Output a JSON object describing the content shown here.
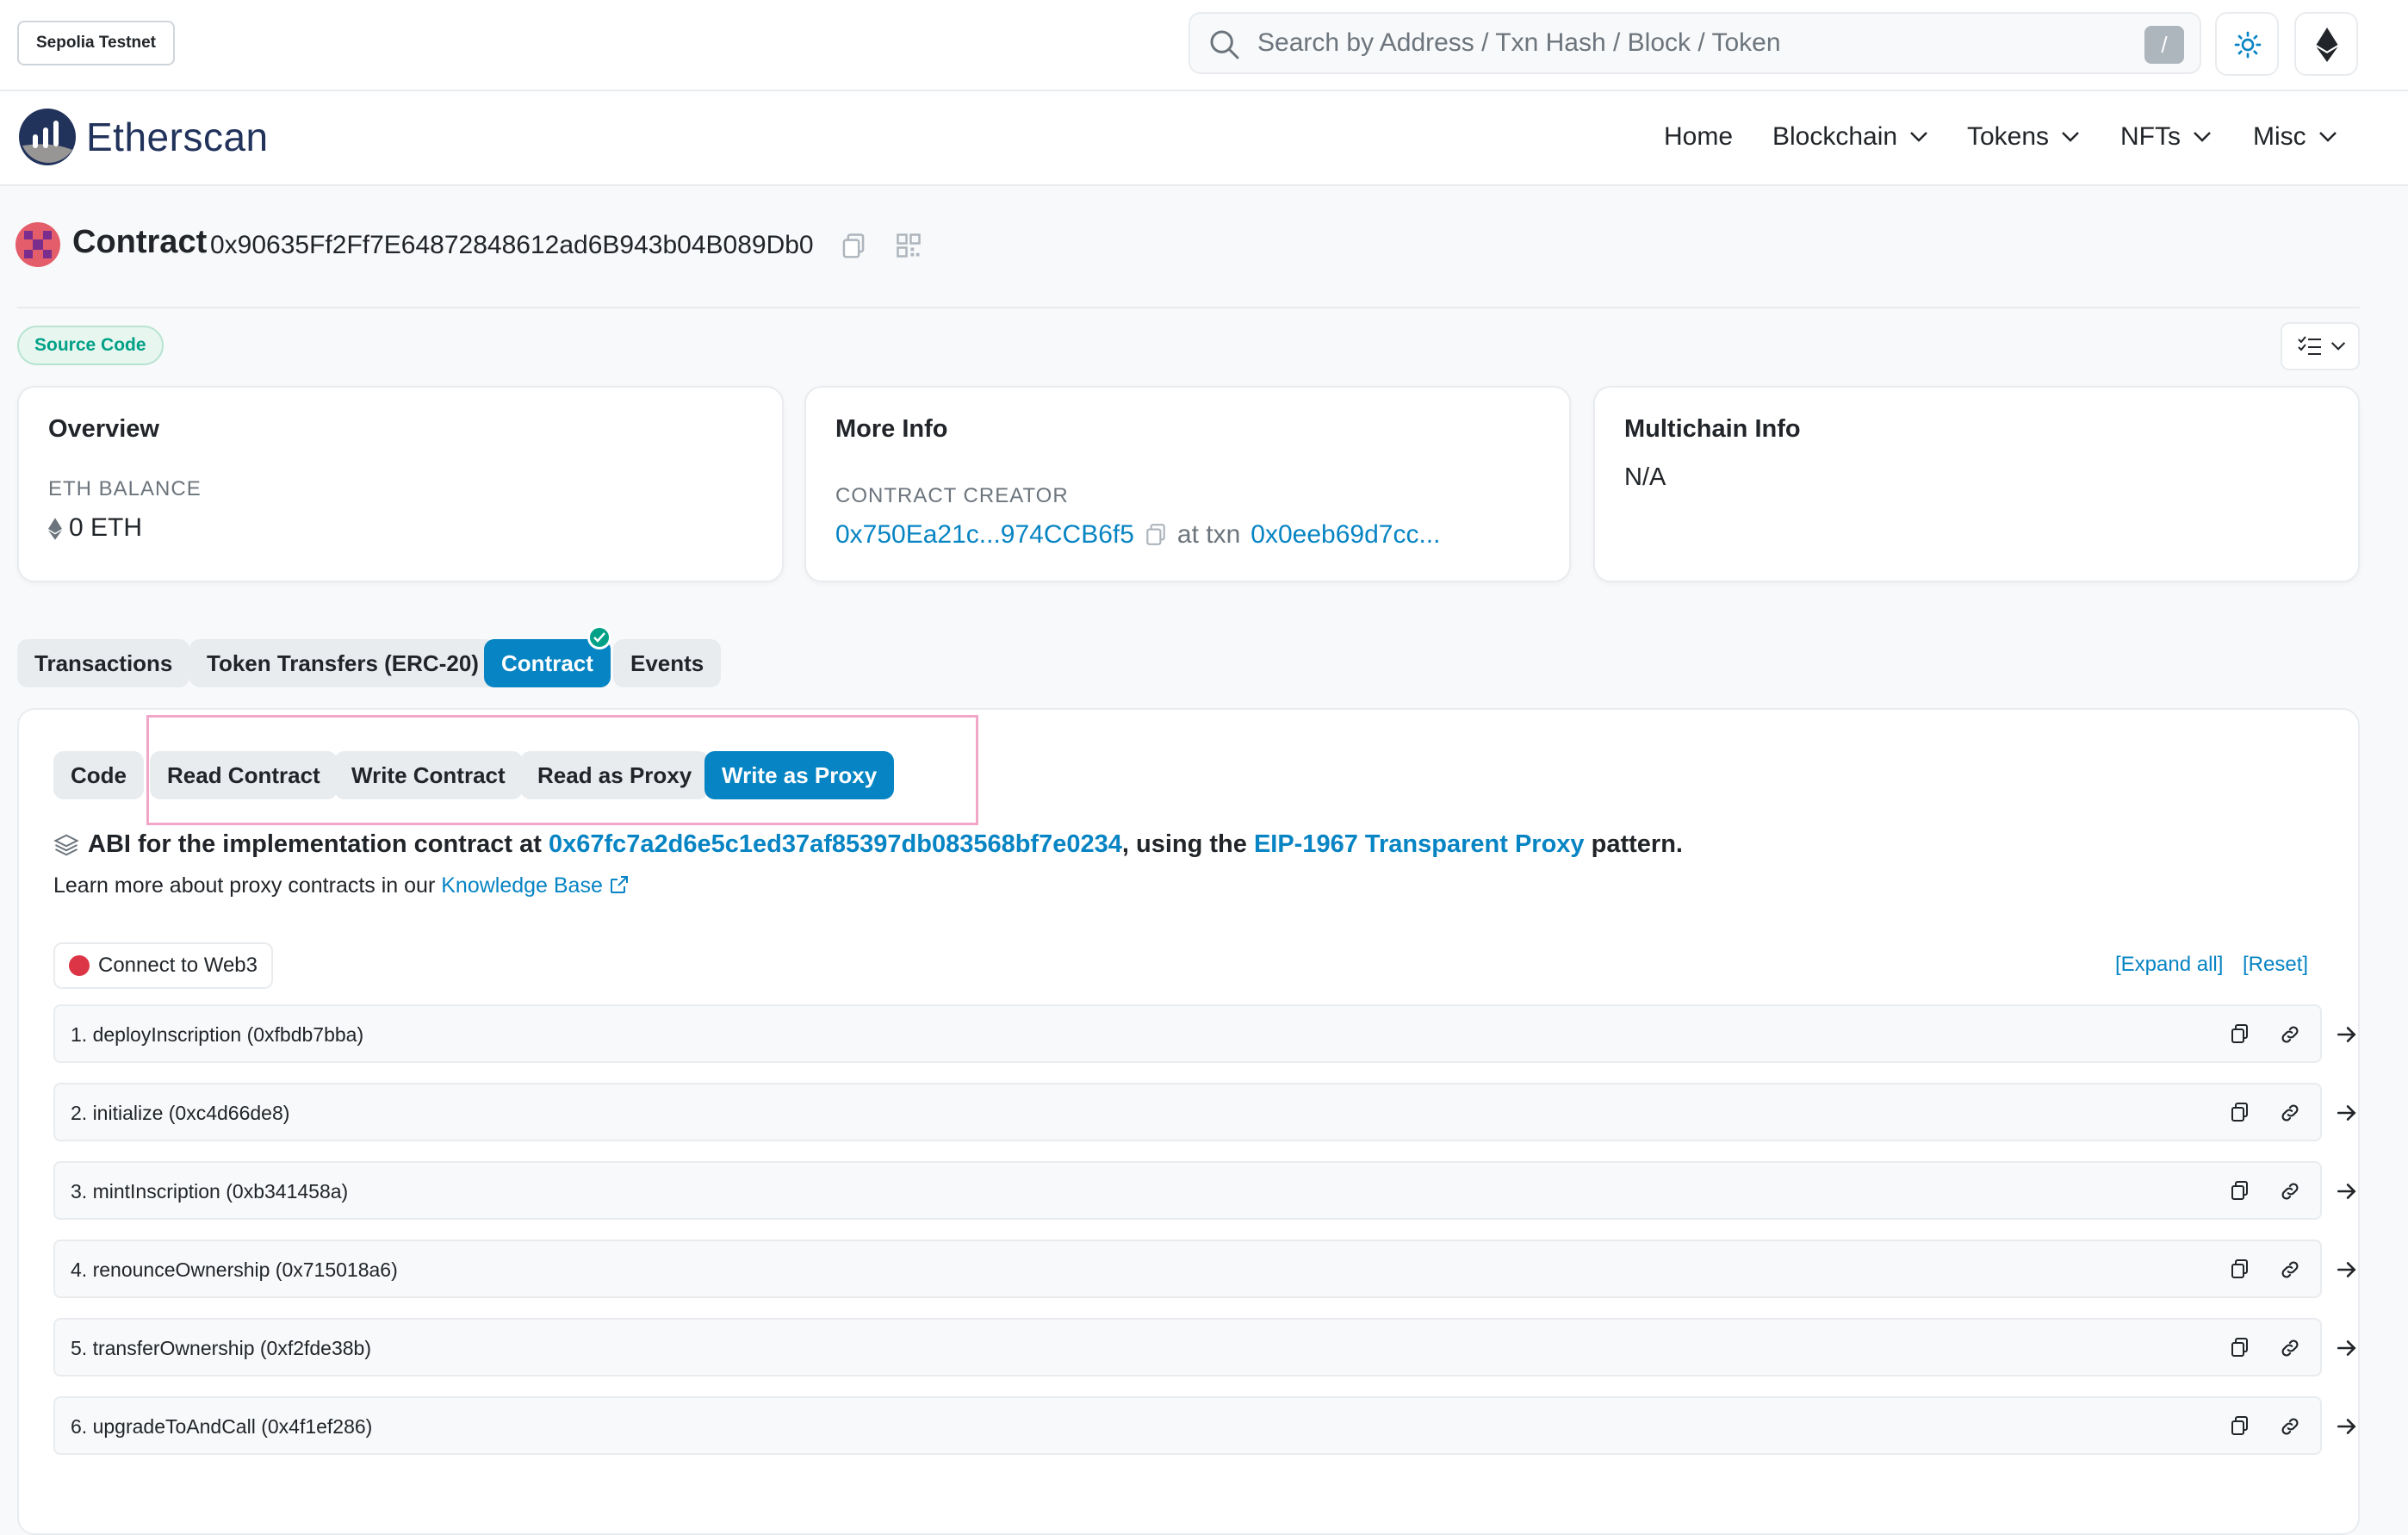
{
  "topbar": {
    "network": "Sepolia Testnet",
    "search_placeholder": "Search by Address / Txn Hash / Block / Token",
    "search_shortcut": "/"
  },
  "nav": {
    "brand": "Etherscan",
    "items": [
      "Home",
      "Blockchain",
      "Tokens",
      "NFTs",
      "Misc"
    ]
  },
  "contract": {
    "label": "Contract",
    "address": "0x90635Ff2Ff7E64872848612ad6B943b04B089Db0",
    "source_badge": "Source Code"
  },
  "overview": {
    "title": "Overview",
    "eth_balance_label": "ETH BALANCE",
    "eth_balance": "0 ETH"
  },
  "more_info": {
    "title": "More Info",
    "creator_label": "CONTRACT CREATOR",
    "creator_address": "0x750Ea21c...974CCB6f5",
    "at_txn_text": "at txn",
    "txn_hash": "0x0eeb69d7cc..."
  },
  "multichain": {
    "title": "Multichain Info",
    "value": "N/A"
  },
  "tabs": [
    "Transactions",
    "Token Transfers (ERC-20)",
    "Contract",
    "Events"
  ],
  "subtabs": [
    "Code",
    "Read Contract",
    "Write Contract",
    "Read as Proxy",
    "Write as Proxy"
  ],
  "abi": {
    "prefix": "ABI for the implementation contract at ",
    "impl_address": "0x67fc7a2d6e5c1ed37af85397db083568bf7e0234",
    "middle": ", using the ",
    "pattern_link": "EIP-1967 Transparent Proxy",
    "suffix": " pattern.",
    "learn_prefix": "Learn more about proxy contracts in our ",
    "learn_link": "Knowledge Base"
  },
  "actions": {
    "connect": "Connect to Web3",
    "expand_all": "[Expand all]",
    "reset": "[Reset]"
  },
  "functions": [
    "1. deployInscription (0xfbdb7bba)",
    "2. initialize (0xc4d66de8)",
    "3. mintInscription (0xb341458a)",
    "4. renounceOwnership (0x715018a6)",
    "5. transferOwnership (0xf2fde38b)",
    "6. upgradeToAndCall (0x4f1ef286)"
  ],
  "colors": {
    "accent": "#0784c3",
    "success": "#00a186",
    "danger": "#dc3545",
    "highlight": "#f2a6c8"
  }
}
